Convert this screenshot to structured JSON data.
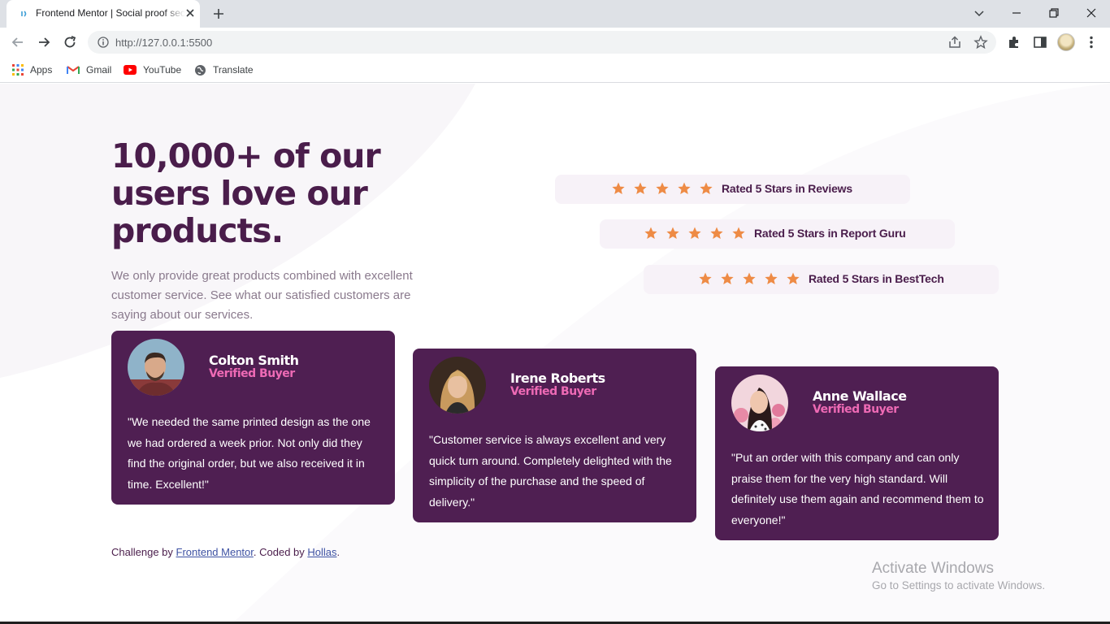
{
  "browser": {
    "tab_title": "Frontend Mentor | Social proof section",
    "url": "http://127.0.0.1:5500",
    "bookmarks": [
      {
        "label": "Apps",
        "icon": "apps-grid-icon"
      },
      {
        "label": "Gmail",
        "icon": "gmail-icon"
      },
      {
        "label": "YouTube",
        "icon": "youtube-icon"
      },
      {
        "label": "Translate",
        "icon": "translate-globe-icon"
      }
    ]
  },
  "hero": {
    "headline": "10,000+ of our users love our products.",
    "intro": "We only provide great products combined with excellent customer service. See what our satisfied customers are saying about our services."
  },
  "ratings": [
    {
      "stars": 5,
      "text": "Rated 5 Stars in Reviews"
    },
    {
      "stars": 5,
      "text": "Rated 5 Stars in Report Guru"
    },
    {
      "stars": 5,
      "text": "Rated 5 Stars in BestTech"
    }
  ],
  "testimonials": [
    {
      "name": "Colton Smith",
      "role": "Verified Buyer",
      "quote": "\"We needed the same printed design as the one we had ordered a week prior. Not only did they find the original order, but we also received it in time. Excellent!\""
    },
    {
      "name": "Irene Roberts",
      "role": "Verified Buyer",
      "quote": "\"Customer service is always excellent and very quick turn around. Completely delighted with the simplicity of the purchase and the speed of delivery.\""
    },
    {
      "name": "Anne Wallace",
      "role": "Verified Buyer",
      "quote": "\"Put an order with this company and can only praise them for the very high standard. Will definitely use them again and recommend them to everyone!\""
    }
  ],
  "footer": {
    "prefix": "Challenge by ",
    "link1": "Frontend Mentor",
    "middle": ". Coded by ",
    "link2": "Hollas",
    "suffix": "."
  },
  "watermark": {
    "title": "Activate Windows",
    "subtitle": "Go to Settings to activate Windows."
  },
  "colors": {
    "primary": "#4a1d4b",
    "card": "#4f1f52",
    "accent_pink": "#ee6ab5",
    "star": "#ee8b45",
    "rating_bg": "#f7f2f8"
  }
}
